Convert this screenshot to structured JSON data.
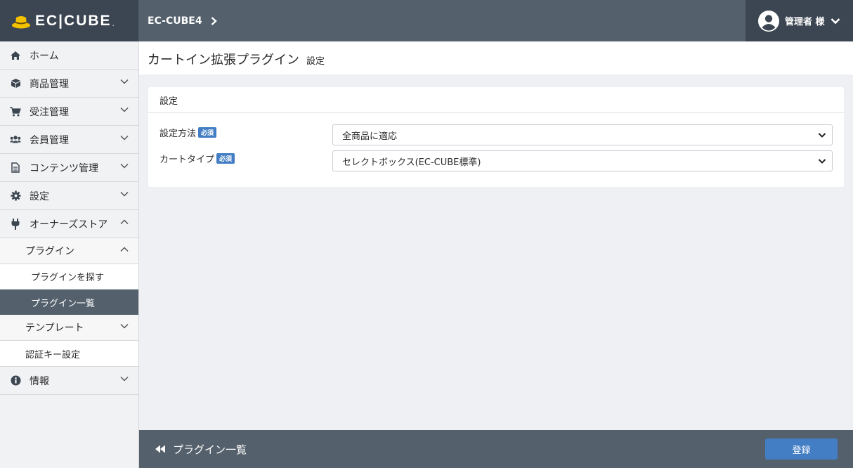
{
  "header": {
    "logo_text": "EC|CUBE",
    "logo_dot": ".",
    "shop_name": "EC-CUBE4",
    "user_label": "管理者 様"
  },
  "sidebar": {
    "items": [
      {
        "label": "ホーム",
        "icon": "home-icon"
      },
      {
        "label": "商品管理",
        "icon": "cube-icon"
      },
      {
        "label": "受注管理",
        "icon": "cart-icon"
      },
      {
        "label": "会員管理",
        "icon": "users-icon"
      },
      {
        "label": "コンテンツ管理",
        "icon": "file-icon"
      },
      {
        "label": "設定",
        "icon": "gear-icon"
      },
      {
        "label": "オーナーズストア",
        "icon": "plug-icon"
      }
    ],
    "plugin_group": "プラグイン",
    "plugin_search": "プラグインを探す",
    "plugin_list": "プラグイン一覧",
    "template": "テンプレート",
    "auth_key": "認証キー設定",
    "info": "情報"
  },
  "page": {
    "title": "カートイン拡張プラグイン",
    "subtitle": "設定"
  },
  "card": {
    "title": "設定",
    "required_badge": "必須",
    "fields": [
      {
        "label": "設定方法",
        "value": "全商品に適応"
      },
      {
        "label": "カートタイプ",
        "value": "セレクトボックス(EC-CUBE標準)"
      }
    ]
  },
  "footer": {
    "back_label": "プラグイン一覧",
    "submit_label": "登録"
  },
  "colors": {
    "header_bg": "#54606c",
    "header_dark": "#3c4652",
    "accent": "#437ec4"
  }
}
